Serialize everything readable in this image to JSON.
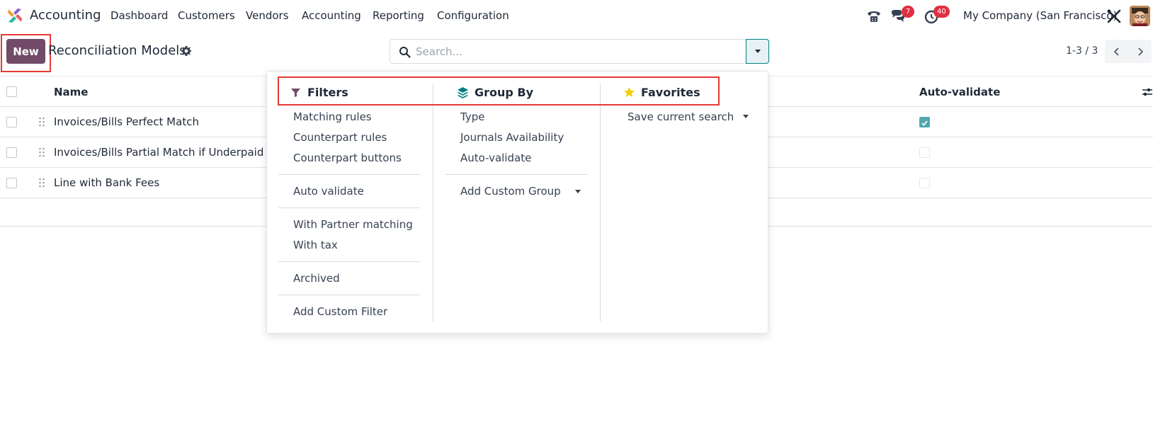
{
  "nav": {
    "app_name": "Accounting",
    "menus": [
      "Dashboard",
      "Customers",
      "Vendors",
      "Accounting",
      "Reporting",
      "Configuration"
    ],
    "messages_count": "7",
    "activities_count": "40",
    "company": "My Company (San Francisco)"
  },
  "control": {
    "new_label": "New",
    "title": "Reconciliation Models",
    "search_placeholder": "Search...",
    "pager": "1-3 / 3"
  },
  "list": {
    "columns": [
      "Name",
      "Auto-validate"
    ],
    "rows": [
      {
        "name": "Invoices/Bills Perfect Match",
        "auto_validate": true
      },
      {
        "name": "Invoices/Bills Partial Match if Underpaid",
        "auto_validate": false
      },
      {
        "name": "Line with Bank Fees",
        "auto_validate": false
      }
    ]
  },
  "dropdown": {
    "filters": {
      "title": "Filters",
      "items": [
        "Matching rules",
        "Counterpart rules",
        "Counterpart buttons",
        "Auto validate",
        "With Partner matching",
        "With tax",
        "Archived",
        "Add Custom Filter"
      ]
    },
    "group_by": {
      "title": "Group By",
      "items": [
        "Type",
        "Journals Availability",
        "Auto-validate",
        "Add Custom Group"
      ]
    },
    "favorites": {
      "title": "Favorites",
      "items": [
        "Save current search"
      ]
    }
  },
  "colors": {
    "primary": "#714b67",
    "accent": "#017e84",
    "highlight": "#e53935",
    "badge": "#e02f42",
    "favorite_star": "#f3cc00"
  }
}
